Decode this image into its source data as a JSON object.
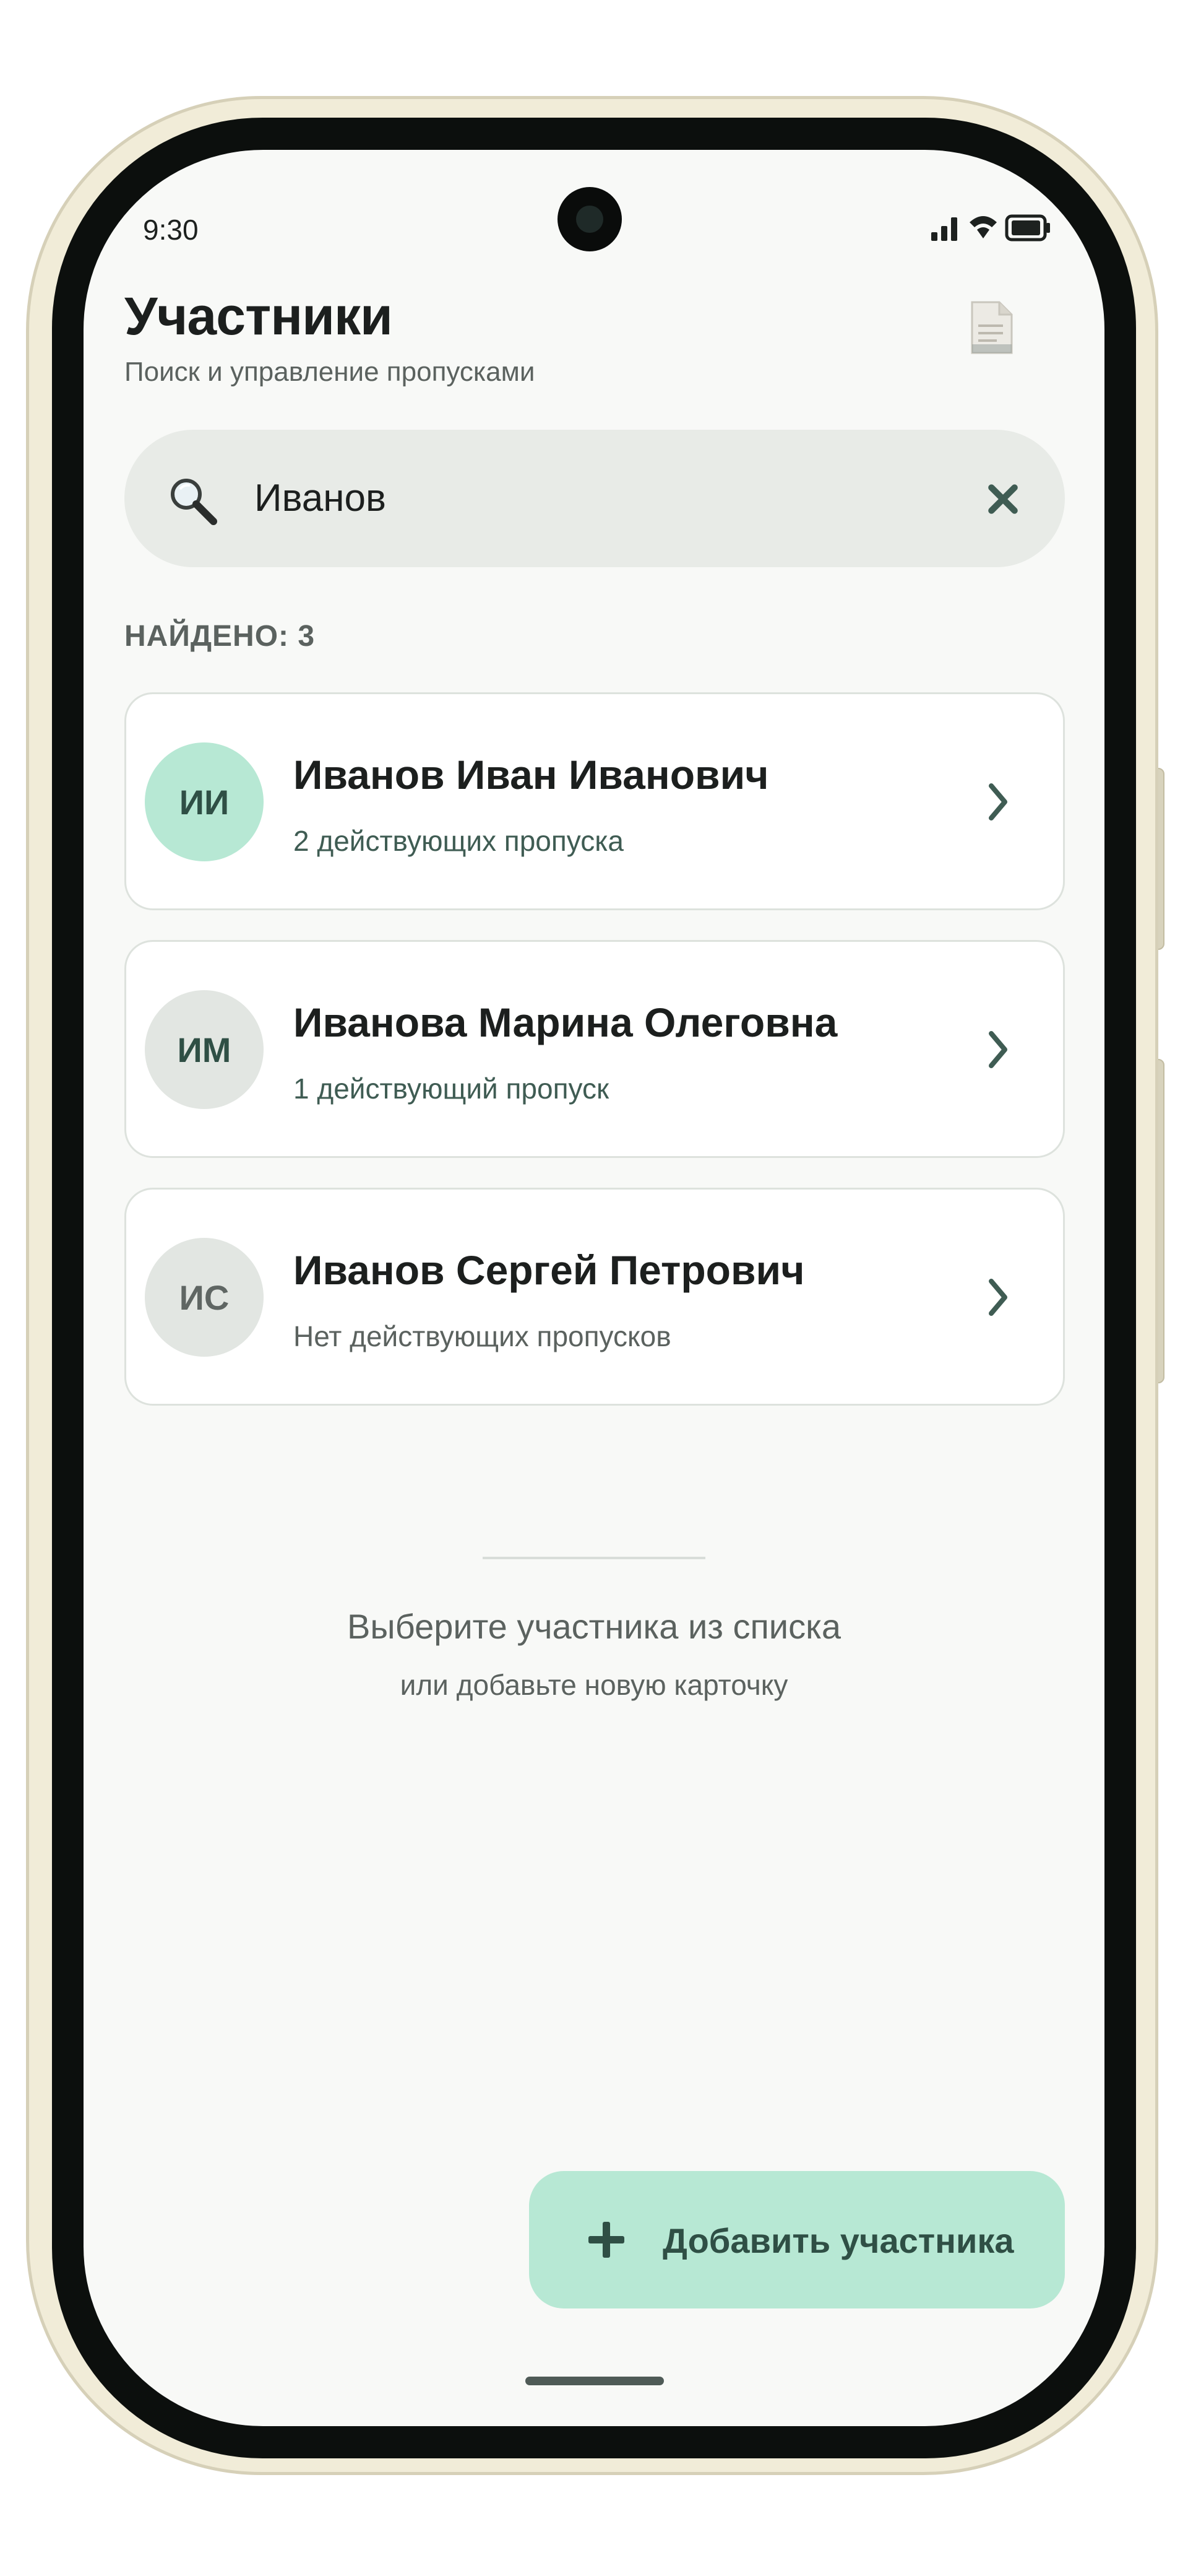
{
  "status_bar": {
    "time": "9:30"
  },
  "header": {
    "title": "Участники",
    "subtitle": "Поиск и управление пропусками",
    "action_icon": "document-icon"
  },
  "search": {
    "value": "Иванов",
    "placeholder": "Поиск",
    "icon": "search-icon",
    "clear_icon": "close-icon"
  },
  "results": {
    "count_label": "НАЙДЕНО: 3",
    "items": [
      {
        "initials": "ИИ",
        "name": "Иванов Иван Иванович",
        "status": "2 действующих пропуска",
        "active": true
      },
      {
        "initials": "ИМ",
        "name": "Иванова Марина Олеговна",
        "status": "1 действующий пропуск",
        "active": true
      },
      {
        "initials": "ИС",
        "name": "Иванов Сергей Петрович",
        "status": "Нет действующих пропусков",
        "active": false
      }
    ]
  },
  "empty_state": {
    "title": "Выберите участника из списка",
    "subtitle": "или добавьте новую карточку"
  },
  "add_button": {
    "label": "Добавить участника",
    "icon": "plus-icon"
  },
  "colors": {
    "accent": "#b7e8d4",
    "accent_text": "#2f4f45",
    "background": "#f8f9f7",
    "search_bg": "#e8ebe7"
  }
}
